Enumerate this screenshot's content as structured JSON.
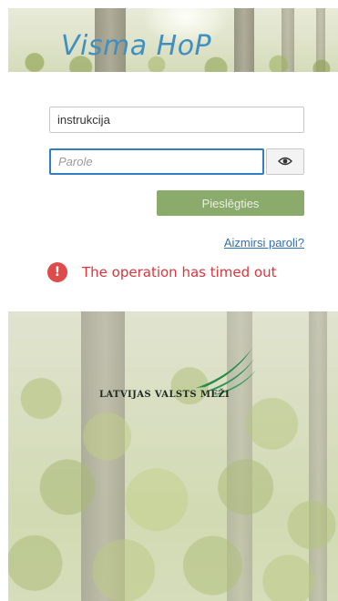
{
  "app": {
    "title": "Visma HoP"
  },
  "login": {
    "username_value": "instrukcija",
    "password_placeholder": "Parole",
    "show_password_icon": "eye-icon",
    "login_button_label": "Pieslēgties",
    "forgot_password_label": "Aizmirsi paroli?"
  },
  "error": {
    "icon": "exclamation-icon",
    "message": "The operation has timed out"
  },
  "logo": {
    "text": "LATVIJAS VALSTS MEŽI"
  },
  "colors": {
    "title": "#3f8fc0",
    "focus_border": "#2f7fc1",
    "login_button": "#8aab6c",
    "link": "#2f6fb3",
    "error": "#d9363e",
    "logo_swoosh": "#2a8a4a"
  }
}
